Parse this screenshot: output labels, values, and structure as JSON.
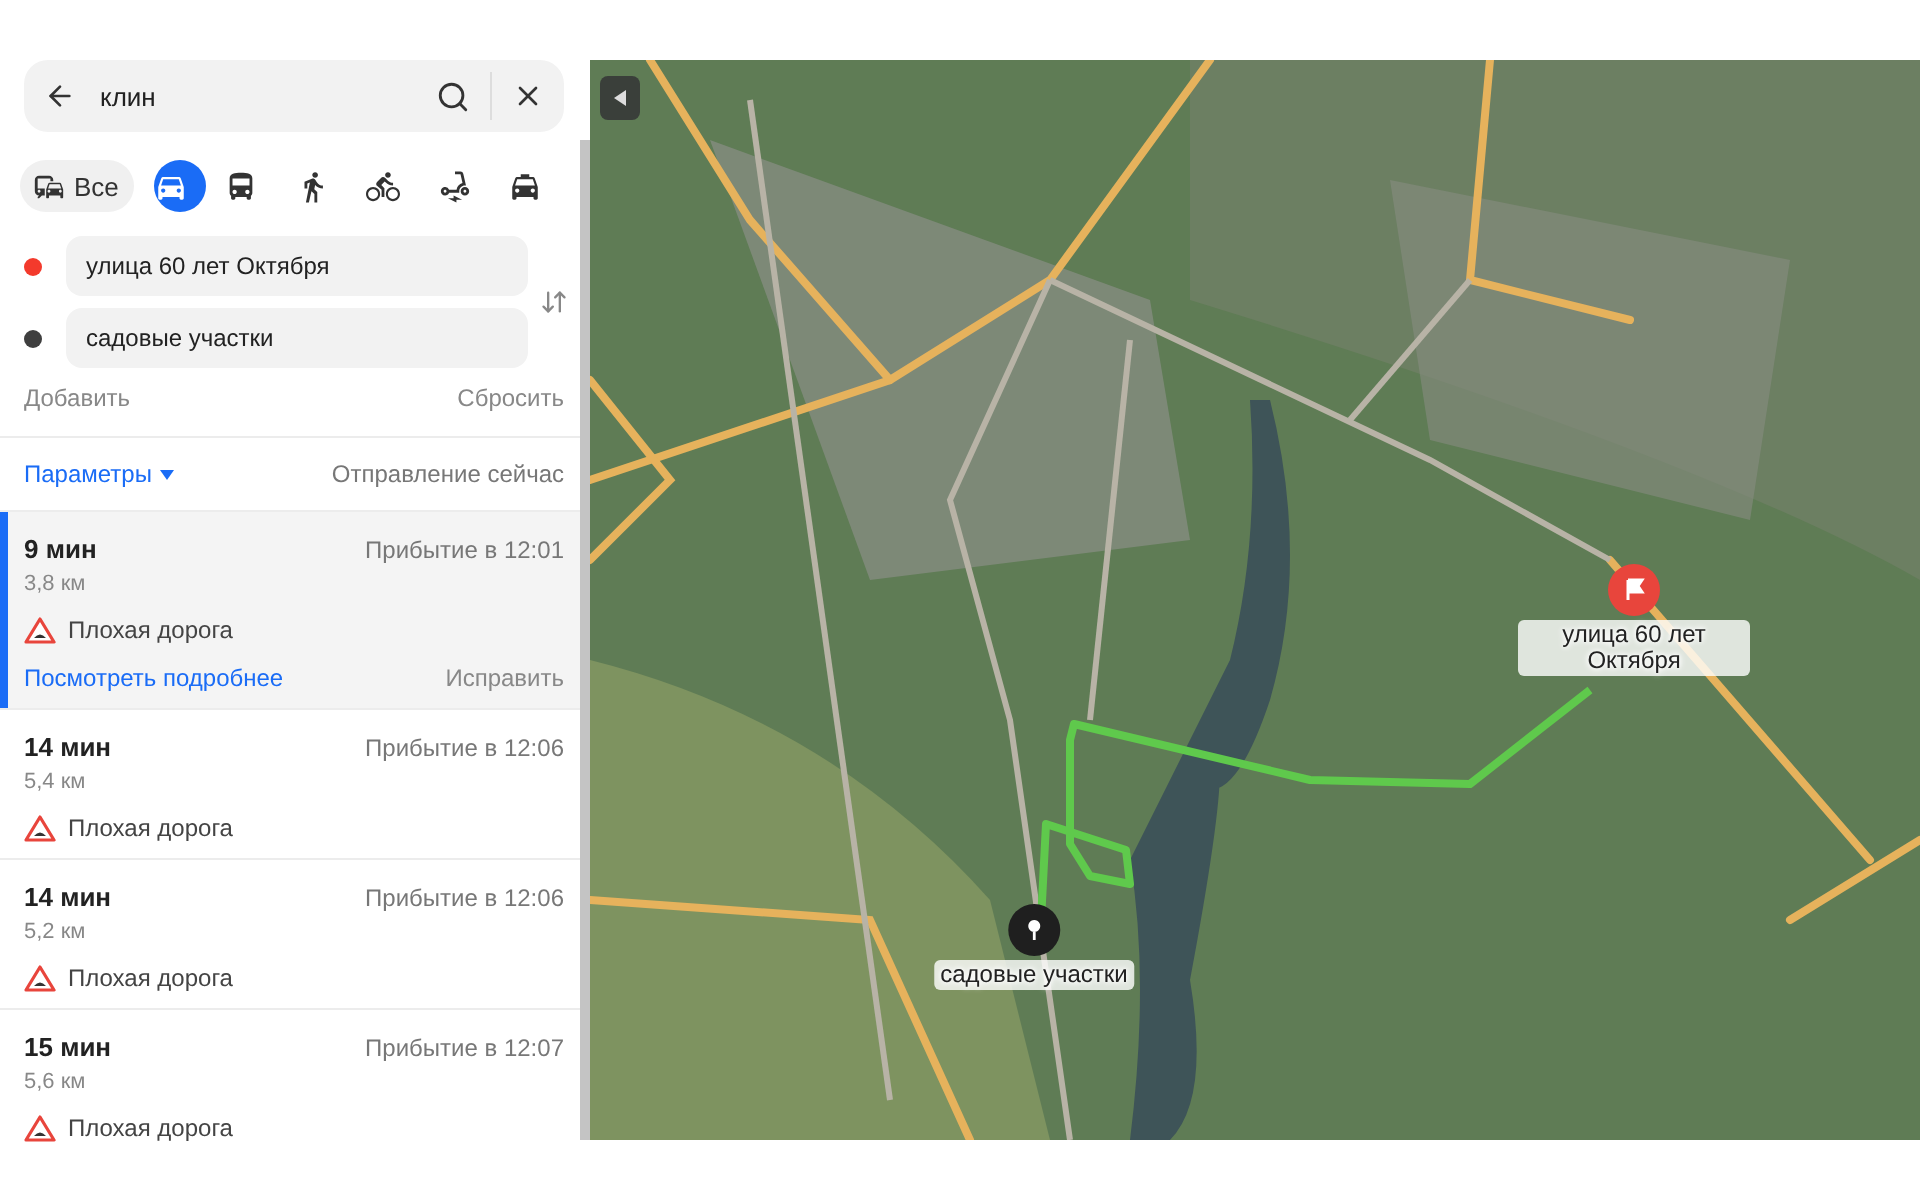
{
  "search": {
    "value": "клин"
  },
  "modes": [
    {
      "kind": "all",
      "label": "Все",
      "selected": false
    },
    {
      "kind": "car",
      "selected": true
    },
    {
      "kind": "bus",
      "selected": false
    },
    {
      "kind": "walk",
      "selected": false
    },
    {
      "kind": "bike",
      "selected": false
    },
    {
      "kind": "scooter",
      "selected": false
    },
    {
      "kind": "taxi",
      "selected": false
    }
  ],
  "waypoints": [
    {
      "value": "улица 60 лет Октября",
      "color": "#f33a2c"
    },
    {
      "value": "садовые участки",
      "color": "#3f3f3f"
    }
  ],
  "add_label": "Добавить",
  "reset_label": "Сбросить",
  "params_label": "Параметры",
  "departure": "Отправление сейчас",
  "routes": [
    {
      "duration": "9 мин",
      "distance": "3,8 км",
      "arrival": "Прибытие в 12:01",
      "warning": "Плохая дорога",
      "selected": true,
      "details_link": "Посмотреть подробнее",
      "fix_link": "Исправить"
    },
    {
      "duration": "14 мин",
      "distance": "5,4 км",
      "arrival": "Прибытие в 12:06",
      "warning": "Плохая дорога",
      "selected": false
    },
    {
      "duration": "14 мин",
      "distance": "5,2 км",
      "arrival": "Прибытие в 12:06",
      "warning": "Плохая дорога",
      "selected": false
    },
    {
      "duration": "15 мин",
      "distance": "5,6 км",
      "arrival": "Прибытие в 12:07",
      "warning": "Плохая дорога",
      "selected": false
    }
  ],
  "map": {
    "markers": [
      {
        "kind": "destination",
        "label": "улица 60 лет Октября"
      },
      {
        "kind": "origin",
        "label": "садовые участки"
      }
    ]
  }
}
